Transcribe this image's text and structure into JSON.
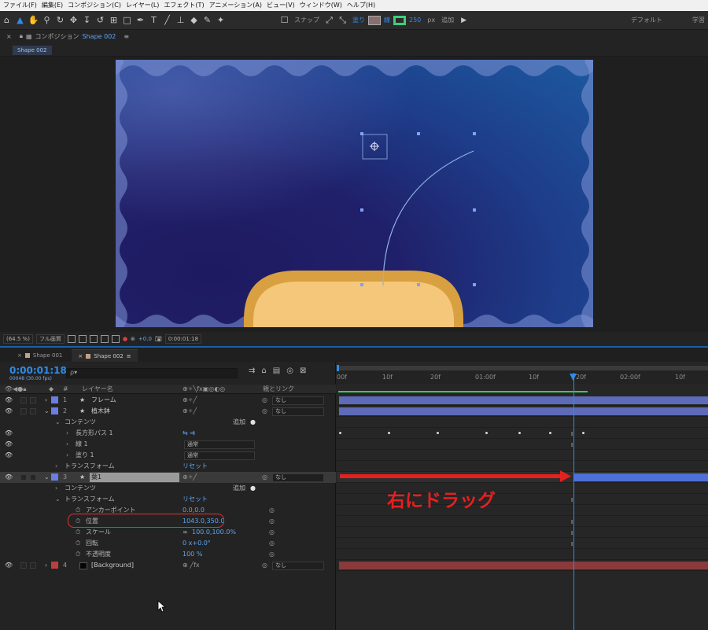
{
  "menu": [
    "ファイル(F)",
    "編集(E)",
    "コンポジション(C)",
    "レイヤー(L)",
    "エフェクト(T)",
    "アニメーション(A)",
    "ビュー(V)",
    "ウィンドウ(W)",
    "ヘルプ(H)"
  ],
  "toolbar": {
    "snap_label": "スナップ",
    "fill_label": "塗り",
    "stroke_label": "線",
    "stroke_px": "250",
    "px_unit": "px",
    "add_label": "追加",
    "workspace_default": "デフォルト",
    "workspace_learn": "学習"
  },
  "composition": {
    "panel_label": "コンポジション",
    "panel_comp": "Shape 002",
    "tab_chip": "Shape 002"
  },
  "viewer": {
    "zoom": "(64.5 %)",
    "resolution": "フル画質",
    "exposure": "+0.0",
    "time": "0:00:01:18"
  },
  "timeline": {
    "tabs": [
      {
        "label": "Shape 001",
        "active": false
      },
      {
        "label": "Shape 002",
        "active": true
      }
    ],
    "timecode": "0:00:01:18",
    "timecode_sub": "00048 (30.00 fps)",
    "search_placeholder": "ρ▾",
    "columns": {
      "num": "#",
      "layer_name": "レイヤー名",
      "parent": "親とリンク"
    },
    "ruler_labels": [
      "00f",
      "10f",
      "20f",
      "01:00f",
      "10f",
      "20f",
      "02:00f",
      "10f"
    ],
    "layers": [
      {
        "num": "1",
        "name": "フレーム",
        "color": "#6a7ee0",
        "parent": "なし"
      },
      {
        "num": "2",
        "name": "植木鉢",
        "color": "#6a7ee0",
        "parent": "なし"
      },
      {
        "num": "3",
        "name": "葉1",
        "color": "#6a7ee0",
        "parent": "なし"
      },
      {
        "num": "4",
        "name": "[Background]",
        "color": "#b84040",
        "parent": "なし"
      }
    ],
    "l2_contents": "コンテンツ",
    "l2_add": "追加",
    "l2_path": "長方形パス 1",
    "l2_stroke": "線 1",
    "l2_stroke_mode": "通常",
    "l2_fill": "塗り 1",
    "l2_fill_mode": "通常",
    "l2_transform": "トランスフォーム",
    "l2_reset": "リセット",
    "l3_contents": "コンテンツ",
    "l3_add": "追加",
    "l3_transform": "トランスフォーム",
    "l3_reset": "リセット",
    "props": [
      {
        "name": "アンカーポイント",
        "value": "0.0,0.0"
      },
      {
        "name": "位置",
        "value": "1043.0,350.0"
      },
      {
        "name": "スケール",
        "value": "100.0,100.0%"
      },
      {
        "name": "回転",
        "value": "0 x+0.0°"
      },
      {
        "name": "不透明度",
        "value": "100 %"
      }
    ],
    "annotation": "右にドラッグ"
  }
}
